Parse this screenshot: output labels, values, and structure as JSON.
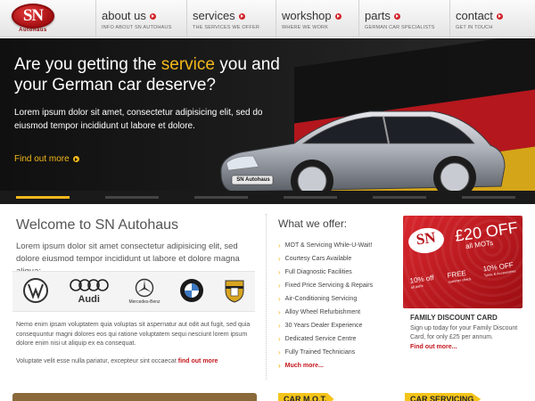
{
  "logo": {
    "text": "SN",
    "sub": "Autohaus"
  },
  "nav": [
    {
      "title": "about us",
      "sub": "INFO ABOUT SN AUTOHAUS"
    },
    {
      "title": "services",
      "sub": "THE SERVICES WE OFFER"
    },
    {
      "title": "workshop",
      "sub": "WHERE WE WORK"
    },
    {
      "title": "parts",
      "sub": "GERMAN CAR SPECIALISTS"
    },
    {
      "title": "contact",
      "sub": "GET IN TOUCH"
    }
  ],
  "hero": {
    "title_pre": "Are you getting the ",
    "title_highlight": "service",
    "title_post": " you and your German car deserve?",
    "text": "Lorem ipsum dolor sit amet, consectetur adipisicing elit, sed do eiusmod tempor incididunt ut labore et dolore.",
    "link": "Find out more",
    "plate": "SN Autohaus",
    "slides": 6,
    "active_slide": 1
  },
  "welcome": {
    "title": "Welcome to SN Autohaus",
    "intro": "Lorem ipsum dolor sit amet consectetur adipisicing elit, sed dolore eiusmod tempor incididunt ut labore et dolore magna aliqua:",
    "brands": [
      "",
      "Audi",
      "Mercedes-Benz",
      "",
      ""
    ],
    "body": "Nemo enim ipsam voluptatem quia voluptas sit aspernatur aut odit aut fugit, sed quia consequuntur magni dolores eos qui ratione voluptatem sequi nesciunt lorem ipsum dolore enim nisi ut aliquip ex ea consequat.",
    "foot": "Voluptate velit esse nulla pariatur, excepteur sint occaecat",
    "foot_link": "find out more"
  },
  "offer": {
    "title": "What we offer:",
    "items": [
      "MOT & Servicing While-U-Wait!",
      "Courtesy Cars Available",
      "Full Diagnostic Facilities",
      "Fixed Price Servicing & Repairs",
      "Air-Conditioning Servicing",
      "Alloy Wheel Refurbishment",
      "30 Years Dealer Experience",
      "Dedicated Service Centre",
      "Fully Trained Technicians"
    ],
    "more": "Much more..."
  },
  "voucher": {
    "logo": "SN",
    "price": "£20 OFF",
    "all_mots": "all MOTs",
    "off1": "10% off",
    "off1_sub": "all parts",
    "off2": "FREE",
    "off2_sub": "summer check",
    "off3": "10% OFF",
    "off3_sub": "Tyres & Accessories"
  },
  "family": {
    "title": "FAMILY DISCOUNT CARD",
    "text": "Sign up today for your Family Discount Card, for only £25 per annum.",
    "link": "Find out more..."
  },
  "bottom": {
    "tag1": "CAR M.O.T.",
    "tag2": "CAR SERVICING"
  },
  "colors": {
    "accent": "#f4b81b",
    "red": "#c4161c",
    "hero_bg": "#141414"
  }
}
